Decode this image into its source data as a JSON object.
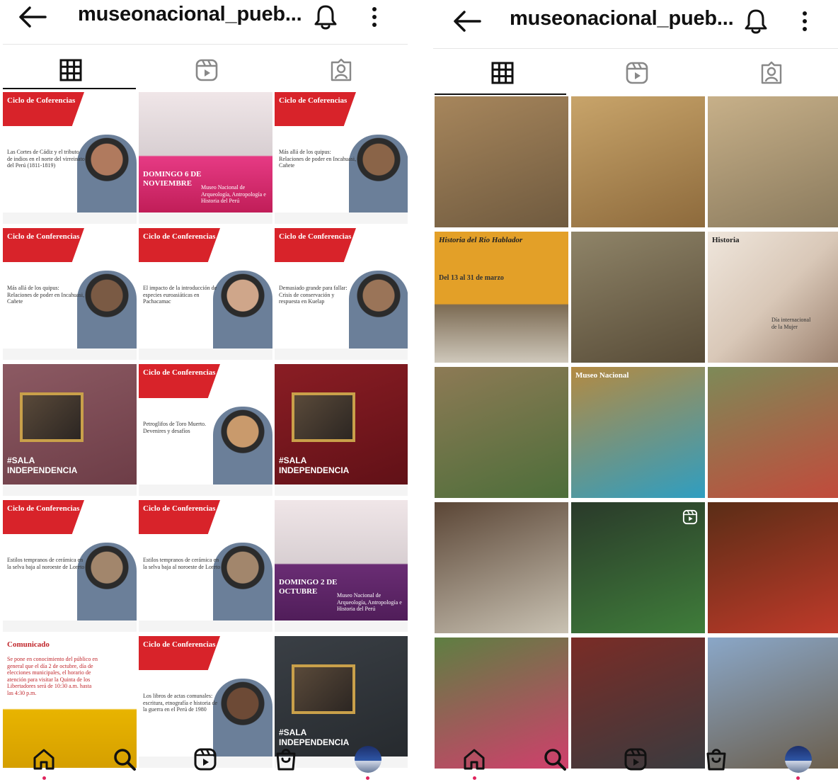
{
  "left": {
    "header": {
      "title": "museonacional_pueb..."
    },
    "posts": [
      {
        "caption": "Ciclo de Coferencias",
        "subtitle": "Las Cortes de Cádiz y el tributo de indios en el norte del virreinato del Perú (1811-1819)",
        "bg": "#ffffff",
        "accent": "#d8232a",
        "style": "conf",
        "portrait": "#b07a5e"
      },
      {
        "caption": "DOMINGO 6 DE NOVIEMBRE",
        "subtitle": "Museo Nacional de Arqueología, Antropología e Historia del Perú",
        "bg": "#e63a84",
        "accent": "#b9184f",
        "style": "mua",
        "portrait": ""
      },
      {
        "caption": "Ciclo de Coferencias",
        "subtitle": "Más allá de los quipus: Relaciones de poder en Incahuasi, Cañete",
        "bg": "#ffffff",
        "accent": "#d8232a",
        "style": "conf",
        "portrait": "#8a6448"
      },
      {
        "caption": "Ciclo de Conferencias",
        "subtitle": "Más allá de los quipus: Relaciones de poder en Incahuasi, Cañete",
        "bg": "#ffffff",
        "accent": "#d8232a",
        "style": "conf",
        "portrait": "#7a5a44"
      },
      {
        "caption": "Ciclo de Conferencias",
        "subtitle": "El impacto de la introducción de especies euroasiáticas en Pachacamac",
        "bg": "#ffffff",
        "accent": "#d8232a",
        "style": "conf",
        "portrait": "#cfa68a"
      },
      {
        "caption": "Ciclo de Conferencias",
        "subtitle": "Demasiado grande para fallar: Crisis de conservación y respuesta en Kuelap",
        "bg": "#ffffff",
        "accent": "#d8232a",
        "style": "conf",
        "portrait": "#9a7458"
      },
      {
        "caption": "#SALA INDEPENDENCIA",
        "subtitle": "",
        "bg": "#8c5a63",
        "accent": "#6b3b45",
        "style": "sala",
        "portrait": ""
      },
      {
        "caption": "Ciclo de Conferencias",
        "subtitle": "Petroglifos de Toro Muerto. Devenires y desafíos",
        "bg": "#ffffff",
        "accent": "#d8232a",
        "style": "conf",
        "portrait": "#c99a6c"
      },
      {
        "caption": "#SALA INDEPENDENCIA",
        "subtitle": "",
        "bg": "#8a1d24",
        "accent": "#5e1016",
        "style": "sala",
        "portrait": ""
      },
      {
        "caption": "Ciclo de Conferencias",
        "subtitle": "Estilos tempranos de cerámica en la selva baja al noroeste de Loreto",
        "bg": "#ffffff",
        "accent": "#d8232a",
        "style": "conf",
        "portrait": "#a2866c"
      },
      {
        "caption": "Ciclo de Conferencias",
        "subtitle": "Estilos tempranos de cerámica en la selva baja al noroeste de Loreto",
        "bg": "#ffffff",
        "accent": "#d8232a",
        "style": "conf",
        "portrait": "#a2866c"
      },
      {
        "caption": "DOMINGO 2 DE OCTUBRE",
        "subtitle": "Museo Nacional de Arqueología, Antropología e Historia del Perú",
        "bg": "#6a2d74",
        "accent": "#4b1a54",
        "style": "mua",
        "portrait": ""
      },
      {
        "caption": "Comunicado",
        "subtitle": "Se pone en conocimiento del público en general que el día 2 de octubre, día de elecciones municipales, el horario de atención para visitar la Quinta de los Libertadores será de 10:30 a.m. hasta las 4:30 p.m.",
        "bg": "#ffffff",
        "accent": "#e8b400",
        "style": "notice",
        "portrait": ""
      },
      {
        "caption": "Ciclo de Conferencias",
        "subtitle": "Los libros de actas comunales: escritura, etnografía e historia de la guerra en el Perú de 1980",
        "bg": "#ffffff",
        "accent": "#d8232a",
        "style": "conf",
        "portrait": "#6d4a36"
      },
      {
        "caption": "#SALA INDEPENDENCIA",
        "subtitle": "",
        "bg": "#3a3f45",
        "accent": "#25292d",
        "style": "sala",
        "portrait": ""
      }
    ]
  },
  "right": {
    "header": {
      "title": "museonacional_pueb..."
    },
    "posts": [
      {
        "caption": "",
        "subtitle": "",
        "bg": "#a7865c",
        "accent": "#6f5a3f",
        "style": "photo",
        "portrait": ""
      },
      {
        "caption": "",
        "subtitle": "",
        "bg": "#c8a46a",
        "accent": "#8d6a3c",
        "style": "photo",
        "portrait": ""
      },
      {
        "caption": "",
        "subtitle": "",
        "bg": "#c7b089",
        "accent": "#8a7a5d",
        "style": "photo",
        "portrait": ""
      },
      {
        "caption": "Historia del Río Hablador",
        "subtitle": "Del 13 al 31 de marzo",
        "bg": "#e3a028",
        "accent": "#7c6b53",
        "style": "poster",
        "portrait": ""
      },
      {
        "caption": "",
        "subtitle": "",
        "bg": "#8f8468",
        "accent": "#574b37",
        "style": "photo",
        "portrait": ""
      },
      {
        "caption": "Historia",
        "subtitle": "Día internacional de la Mujer",
        "bg": "#efe6dc",
        "accent": "#9a7f6c",
        "style": "poster-light",
        "portrait": ""
      },
      {
        "caption": "",
        "subtitle": "",
        "bg": "#8d7a55",
        "accent": "#4d6e3a",
        "style": "photo",
        "portrait": ""
      },
      {
        "caption": "Museo Nacional",
        "subtitle": "",
        "bg": "#b48a42",
        "accent": "#2f9ec1",
        "style": "photo",
        "portrait": ""
      },
      {
        "caption": "",
        "subtitle": "",
        "bg": "#7d8a58",
        "accent": "#c24a3b",
        "style": "photo",
        "portrait": ""
      },
      {
        "caption": "",
        "subtitle": "",
        "bg": "#5b4636",
        "accent": "#c9c2b3",
        "style": "photo",
        "portrait": ""
      },
      {
        "caption": "",
        "subtitle": "",
        "bg": "#2a3a2a",
        "accent": "#3f7d3a",
        "style": "reel",
        "portrait": ""
      },
      {
        "caption": "",
        "subtitle": "",
        "bg": "#5a2d16",
        "accent": "#c03a2a",
        "style": "photo",
        "portrait": ""
      },
      {
        "caption": "",
        "subtitle": "",
        "bg": "#5e7f42",
        "accent": "#d03f6c",
        "style": "photo",
        "portrait": ""
      },
      {
        "caption": "",
        "subtitle": "",
        "bg": "#7a2c26",
        "accent": "#3a3b3f",
        "style": "photo",
        "portrait": ""
      },
      {
        "caption": "",
        "subtitle": "",
        "bg": "#8aa7c8",
        "accent": "#6b5e4c",
        "style": "photo",
        "portrait": ""
      }
    ]
  },
  "icons": {
    "back": "arrow-left-icon",
    "bell": "bell-icon",
    "more": "more-vertical-icon",
    "grid": "grid-icon",
    "reels": "reels-icon",
    "tagged": "tagged-icon",
    "home": "home-icon",
    "search": "search-icon",
    "shop": "shop-icon"
  },
  "colors": {
    "notification_dot": "#e0245e",
    "text": "#111111"
  }
}
